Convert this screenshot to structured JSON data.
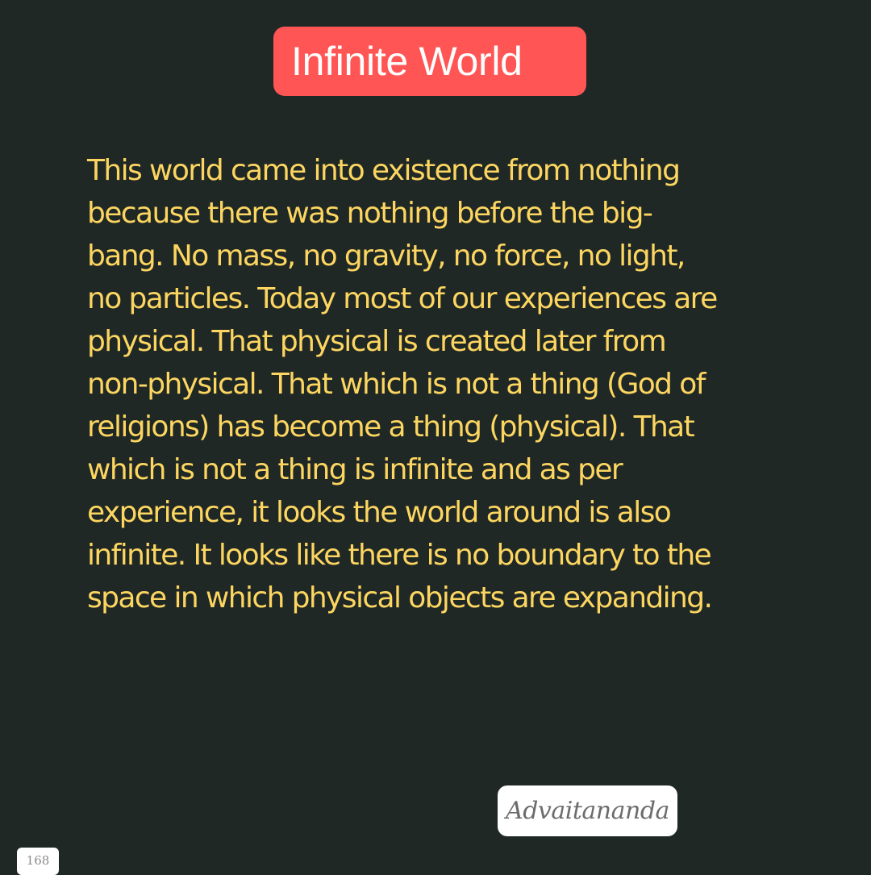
{
  "title": "Infinite World",
  "body_lines": [
    "This world came into existence from nothing",
    "because there was nothing before the big-",
    "bang. No mass, no gravity, no force, no light,",
    "no particles. Today most of our experiences are",
    "physical. That physical is created later from",
    "non-physical. That which is not a thing (God of",
    "religions) has become a thing (physical). That",
    "which is not a thing is infinite and as per",
    "experience, it looks the world around is also",
    "infinite. It looks like there is no boundary to the",
    "space in which physical objects are expanding."
  ],
  "signature": "Advaitananda",
  "page_number": "168",
  "colors": {
    "background": "#202826",
    "title_badge": "#ff5554",
    "body_text": "#fcd660"
  }
}
